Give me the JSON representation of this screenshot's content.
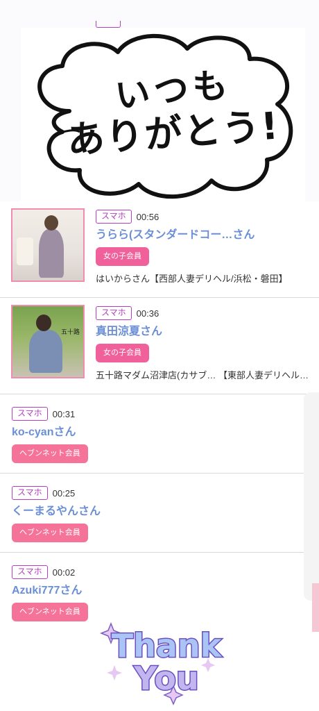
{
  "bubble": {
    "line1": "いつも",
    "line2": "ありがとう!"
  },
  "colors": {
    "accent_tag": "#b43dc0",
    "name_blue": "#6b8fd6",
    "badge_pink": "#f0609a",
    "photo_border": "#f28bb0"
  },
  "items": [
    {
      "tag": "スマホ",
      "time": "00:56",
      "name": "うらら(スタンダードコー…さん",
      "badge": "女の子会員",
      "shop": "はいからさん【西部人妻デリヘル/浜松・磐田】"
    },
    {
      "tag": "スマホ",
      "time": "00:36",
      "name": "真田涼夏さん",
      "badge": "女の子会員",
      "shop": "五十路マダム沼津店(カサブ… 【東部人妻デリヘル/…"
    },
    {
      "tag": "スマホ",
      "time": "00:31",
      "name": "ko-cyanさん",
      "badge": "ヘブンネット会員"
    },
    {
      "tag": "スマホ",
      "time": "00:25",
      "name": "くーまるやんさん",
      "badge": "ヘブンネット会員"
    },
    {
      "tag": "スマホ",
      "time": "00:02",
      "name": "Azuki777さん",
      "badge": "ヘブンネット会員"
    }
  ],
  "thanks": {
    "line1": "Thank",
    "line2": "You"
  }
}
